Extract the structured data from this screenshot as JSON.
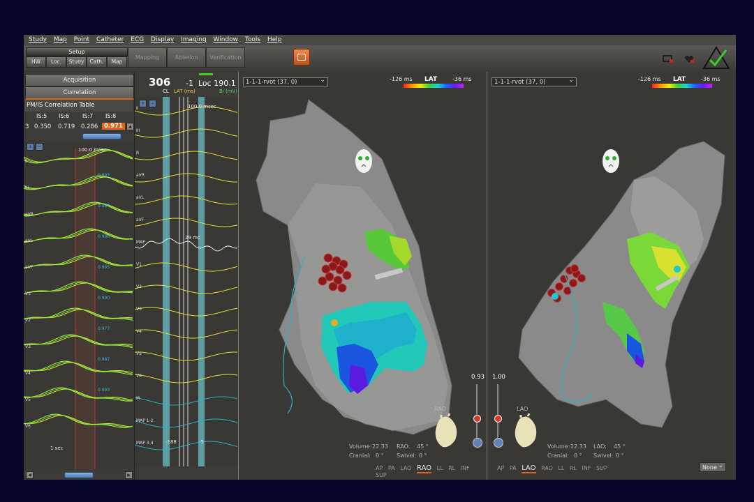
{
  "menu": [
    "Study",
    "Map",
    "Point",
    "Catheter",
    "ECG",
    "Display",
    "Imaging",
    "Window",
    "Tools",
    "Help"
  ],
  "toolbar": {
    "setup": "Setup",
    "sub_buttons": [
      "HW",
      "Loc.",
      "Study",
      "Cath.",
      "Map"
    ],
    "big_buttons": [
      "Mapping",
      "Ablation",
      "Verification"
    ]
  },
  "left_panel": {
    "acquisition": "Acquisition",
    "correlation": "Correlation",
    "table_title": "PM/IS Correlation Table",
    "columns": [
      "IS:5",
      "IS:6",
      "IS:7",
      "IS:8"
    ],
    "row_prefix": "3",
    "values": [
      "0.350",
      "0.719",
      "0.286",
      "0.971"
    ],
    "time_scale": "100.0 msec",
    "footer": "1 sec",
    "lead_labels": [
      "II",
      "III",
      "aVR",
      "aVL",
      "aVF",
      "V1",
      "V2",
      "V3",
      "V4",
      "V5",
      "V6"
    ],
    "lead_values": [
      "0.993",
      "0.994",
      "0.996",
      "0.995",
      "0.990",
      "0.977",
      "0.987",
      "0.993"
    ]
  },
  "mid_panel": {
    "cl_value": "306",
    "cl_label": "CL",
    "lat_value": "-1",
    "lat_label": "LAT (ms)",
    "loc_value": "Loc 190.1",
    "bi_label": "Bi (mV)",
    "scale": "100.0 msec",
    "lead_labels": [
      "II",
      "III",
      "R",
      "aVR",
      "aVL",
      "aVF",
      "MAP",
      "V1",
      "V2",
      "V3",
      "V4",
      "V5",
      "V6",
      "M",
      "MAP 1-2",
      "MAP 3-4"
    ],
    "misc": [
      "29 ms",
      "-188",
      "-5"
    ]
  },
  "map_left": {
    "dropdown": "1-1-1-rvot (37, 0)",
    "lat_title": "LAT",
    "lat_min": "-126 ms",
    "lat_max": "-36 ms",
    "zoom": "0.93",
    "view_name": "RAO",
    "volume_label": "Volume:",
    "volume_value": "22.33",
    "cranial_label": "Cranial:",
    "cranial_value": "0 °",
    "angle_label": "RAO:",
    "angle_value": "45 °",
    "swivel_label": "Swivel:",
    "swivel_value": "0 °",
    "views": [
      "AP",
      "PA",
      "LAO",
      "RAO",
      "LL",
      "RL",
      "INF",
      "SUP"
    ],
    "active_view": "RAO",
    "marker": "R"
  },
  "map_right": {
    "dropdown": "1-1-1-rvot (37, 0)",
    "lat_title": "LAT",
    "lat_min": "-126 ms",
    "lat_max": "-36 ms",
    "zoom": "1.00",
    "view_name": "LAO",
    "volume_label": "Volume:",
    "volume_value": "22.33",
    "cranial_label": "Cranial:",
    "cranial_value": "0 °",
    "angle_label": "LAO:",
    "angle_value": "45 °",
    "swivel_label": "Swivel:",
    "swivel_value": "0 °",
    "views": [
      "AP",
      "PA",
      "LAO",
      "RAO",
      "LL",
      "RL",
      "INF",
      "SUP"
    ],
    "active_view": "LAO",
    "none_select": "None"
  },
  "colors": {
    "accent": "#e0641c",
    "lat_gradient": [
      "#ff2020",
      "#f4ee00",
      "#39d23a",
      "#1a60ff",
      "#c91aff"
    ]
  }
}
